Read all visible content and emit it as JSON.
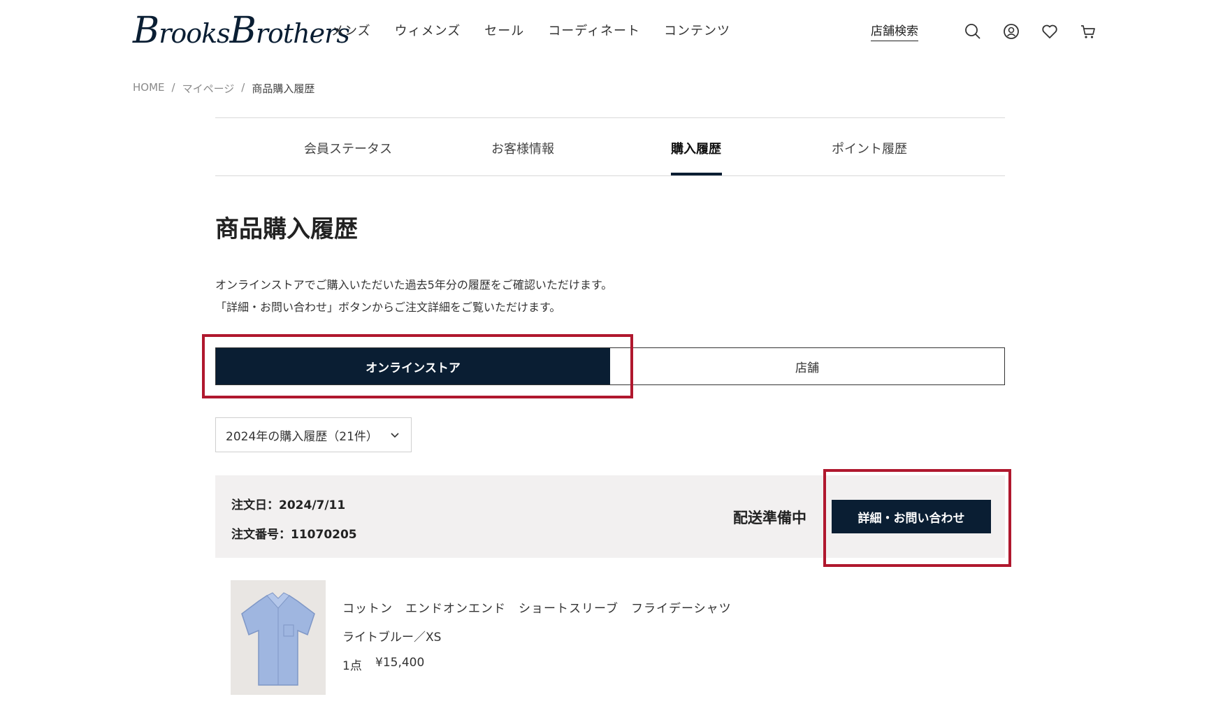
{
  "brand": {
    "logo_text": "Brooks Brothers"
  },
  "nav": {
    "items": [
      "メンズ",
      "ウィメンズ",
      "セール",
      "コーディネート",
      "コンテンツ"
    ]
  },
  "util": {
    "store_search": "店舗検索",
    "icons": [
      "search-icon",
      "account-icon",
      "heart-icon",
      "cart-icon"
    ]
  },
  "breadcrumb": {
    "home": "HOME",
    "mypage": "マイページ",
    "current": "商品購入履歴"
  },
  "tabs": {
    "member_status": "会員ステータス",
    "customer_info": "お客様情報",
    "purchase_history": "購入履歴",
    "point_history": "ポイント履歴",
    "active": "purchase_history"
  },
  "page": {
    "title": "商品購入履歴",
    "intro_line1": "オンラインストアでご購入いただいた過去5年分の履歴をご確認いただけます。",
    "intro_line2": "「詳細・お問い合わせ」ボタンからご注文詳細をご覧いただけます。"
  },
  "channel_toggle": {
    "online": "オンラインストア",
    "store": "店舗",
    "selected": "online"
  },
  "year_select": {
    "value": "2024年の購入履歴（21件）"
  },
  "order": {
    "date": "注文日：2024/7/11",
    "number": "注文番号：11070205",
    "status": "配送準備中",
    "detail_button": "詳細・お問い合わせ",
    "item": {
      "name": "コットン　エンドオンエンド　ショートスリーブ　フライデーシャツ",
      "variant": "ライトブルー／XS",
      "quantity": "1点",
      "price": "¥15,400"
    }
  },
  "colors": {
    "navy": "#0a1e33",
    "highlight": "#b0182e",
    "order_bg": "#f2f0f0"
  }
}
